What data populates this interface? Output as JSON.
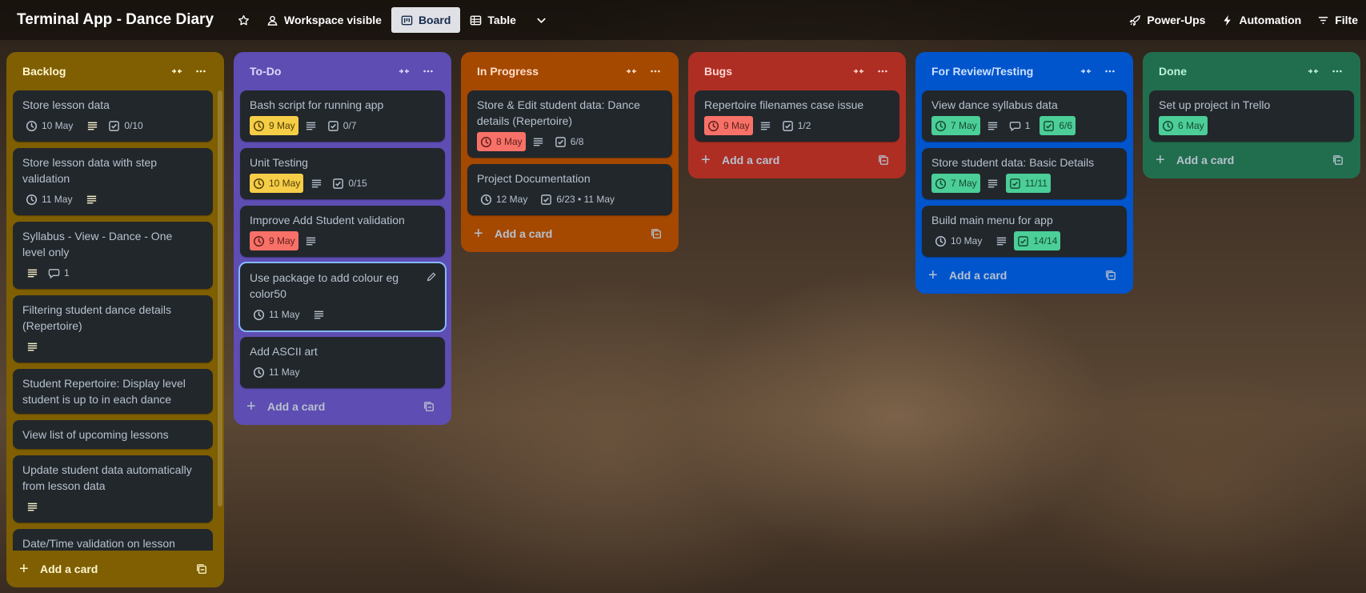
{
  "board": {
    "title": "Terminal App - Dance Diary",
    "workspace_label": "Workspace visible",
    "view_board": "Board",
    "view_table": "Table",
    "powerups": "Power-Ups",
    "automation": "Automation",
    "filters": "Filte"
  },
  "add_card_label": "Add a card",
  "lists": {
    "backlog": {
      "name": "Backlog",
      "cards": [
        {
          "title": "Store lesson data",
          "date": "10 May",
          "checklist": "0/10"
        },
        {
          "title": "Store lesson data with step validation",
          "date": "11 May"
        },
        {
          "title": "Syllabus - View - Dance - One level only",
          "comments": "1"
        },
        {
          "title": "Filtering student dance details (Repertoire)"
        },
        {
          "title": "Student Repertoire: Display level student is up to in each dance"
        },
        {
          "title": "View list of upcoming lessons"
        },
        {
          "title": "Update student data automatically from lesson data"
        },
        {
          "title": "Date/Time validation on lesson"
        }
      ]
    },
    "todo": {
      "name": "To-Do",
      "cards": [
        {
          "title": "Bash script for running app",
          "date": "9 May",
          "checklist": "0/7"
        },
        {
          "title": "Unit Testing",
          "date": "10 May",
          "checklist": "0/15"
        },
        {
          "title": "Improve Add Student validation",
          "date": "9 May"
        },
        {
          "title": "Use package to add colour eg color50",
          "date": "11 May"
        },
        {
          "title": "Add ASCII art",
          "date": "11 May"
        }
      ]
    },
    "progress": {
      "name": "In Progress",
      "cards": [
        {
          "title": "Store & Edit student data: Dance details (Repertoire)",
          "date": "8 May",
          "checklist": "6/8"
        },
        {
          "title": "Project Documentation",
          "date": "12 May",
          "checklist": "6/23 • 11 May"
        }
      ]
    },
    "bugs": {
      "name": "Bugs",
      "cards": [
        {
          "title": "Repertoire filenames case issue",
          "date": "9 May",
          "checklist": "1/2"
        }
      ]
    },
    "review": {
      "name": "For Review/Testing",
      "cards": [
        {
          "title": "View dance syllabus data",
          "date": "7 May",
          "comments": "1",
          "checklist": "6/6"
        },
        {
          "title": "Store student data: Basic Details",
          "date": "7 May",
          "checklist": "11/11"
        },
        {
          "title": "Build main menu for app",
          "date": "10 May",
          "checklist": "14/14"
        }
      ]
    },
    "done": {
      "name": "Done",
      "cards": [
        {
          "title": "Set up project in Trello",
          "date": "6 May"
        }
      ]
    }
  },
  "colors": {
    "backlog": "#7f5f01",
    "todo": "#5e4db2",
    "progress": "#a54800",
    "bugs": "#ae2e24",
    "review": "#0055cc",
    "done": "#216e4e",
    "card_bg": "#22272b",
    "due_soon": "#f5cd47",
    "overdue": "#f87168",
    "complete": "#4bce97"
  },
  "icons": [
    "star-icon",
    "people-icon",
    "board-icon",
    "table-icon",
    "chevron-down-icon",
    "rocket-icon",
    "lightning-icon",
    "filter-icon",
    "collapse-icon",
    "more-icon",
    "clock-icon",
    "description-icon",
    "checklist-icon",
    "comment-icon",
    "plus-icon",
    "template-icon",
    "edit-icon"
  ]
}
